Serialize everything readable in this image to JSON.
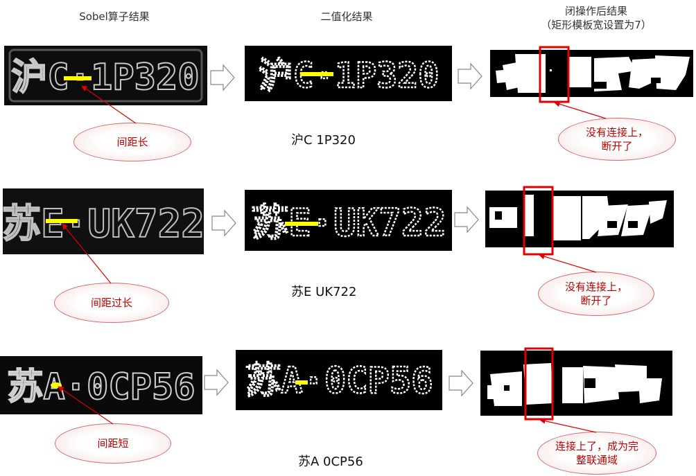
{
  "headers": {
    "sobel": "Sobel算子结果",
    "binary": "二值化结果",
    "close_line1": "闭操作后结果",
    "close_line2": "（矩形模板宽设置为7）"
  },
  "rows": [
    {
      "plate_text": "沪C·1P320",
      "label": "沪C 1P320",
      "gap_note": "间距长",
      "result_line1": "没有连接上，",
      "result_line2": "断开了"
    },
    {
      "plate_text": "苏E·UK722",
      "label": "苏E UK722",
      "gap_note": "间距过长",
      "result_line1": "没有连接上，",
      "result_line2": "断开了"
    },
    {
      "plate_text": "苏A·0CP56",
      "label": "苏A 0CP56",
      "gap_note": "间距短",
      "result_line1": "连接上了，成为完",
      "result_line2": "整联通域"
    }
  ],
  "colors": {
    "highlight_bar": "#ffff00",
    "annotation_red": "#e00000",
    "ellipse_border": "#d46a6a",
    "annotation_text": "#c00000"
  }
}
